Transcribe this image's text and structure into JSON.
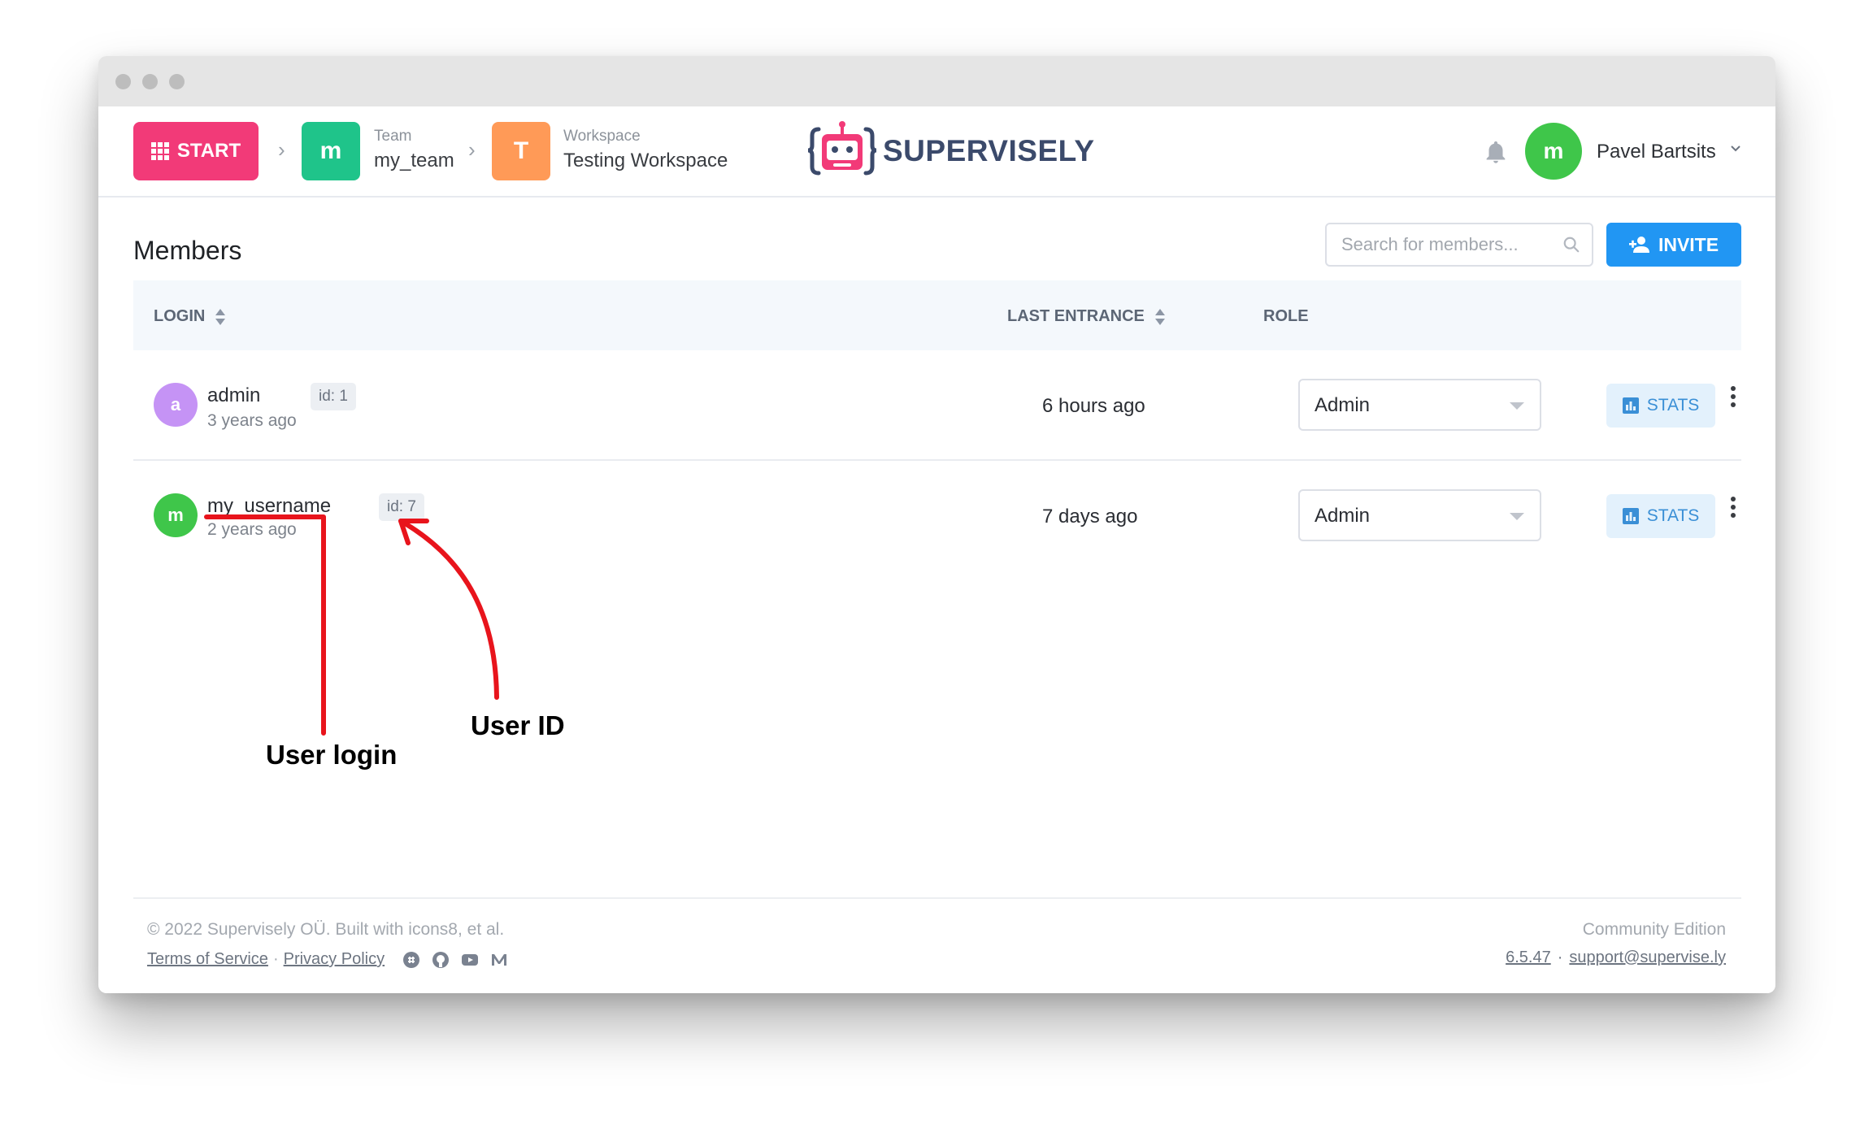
{
  "header": {
    "start_label": "START",
    "team": {
      "caption": "Team",
      "name": "my_team",
      "initial": "m",
      "color": "#1fc48a"
    },
    "workspace": {
      "caption": "Workspace",
      "name": "Testing Workspace",
      "initial": "T",
      "color": "#ff9a57"
    },
    "brand": "SUPERVISELY",
    "user": {
      "initial": "m",
      "name": "Pavel Bartsits"
    }
  },
  "page": {
    "title": "Members",
    "search_placeholder": "Search for members...",
    "invite_label": "INVITE"
  },
  "table": {
    "columns": {
      "login": "LOGIN",
      "last_entrance": "LAST ENTRANCE",
      "role": "ROLE"
    },
    "rows": [
      {
        "initial": "a",
        "avatar_color": "#c593f5",
        "login": "admin",
        "id": "id: 1",
        "created": "3 years ago",
        "last_entrance": "6 hours ago",
        "role": "Admin",
        "stats_label": "STATS"
      },
      {
        "initial": "m",
        "avatar_color": "#3fc64a",
        "login": "my_username",
        "id": "id: 7",
        "created": "2 years ago",
        "last_entrance": "7 days ago",
        "role": "Admin",
        "stats_label": "STATS"
      }
    ]
  },
  "annotations": {
    "login_label": "User login",
    "id_label": "User ID",
    "color": "#e8141c"
  },
  "footer": {
    "copyright": "© 2022 Supervisely OÜ. Built with icons8, et al.",
    "terms": "Terms of Service",
    "separator": "·",
    "privacy": "Privacy Policy",
    "edition": "Community Edition",
    "version": "6.5.47",
    "support": "support@supervise.ly",
    "social_icons": [
      "slack-icon",
      "github-icon",
      "youtube-icon",
      "medium-icon"
    ]
  }
}
